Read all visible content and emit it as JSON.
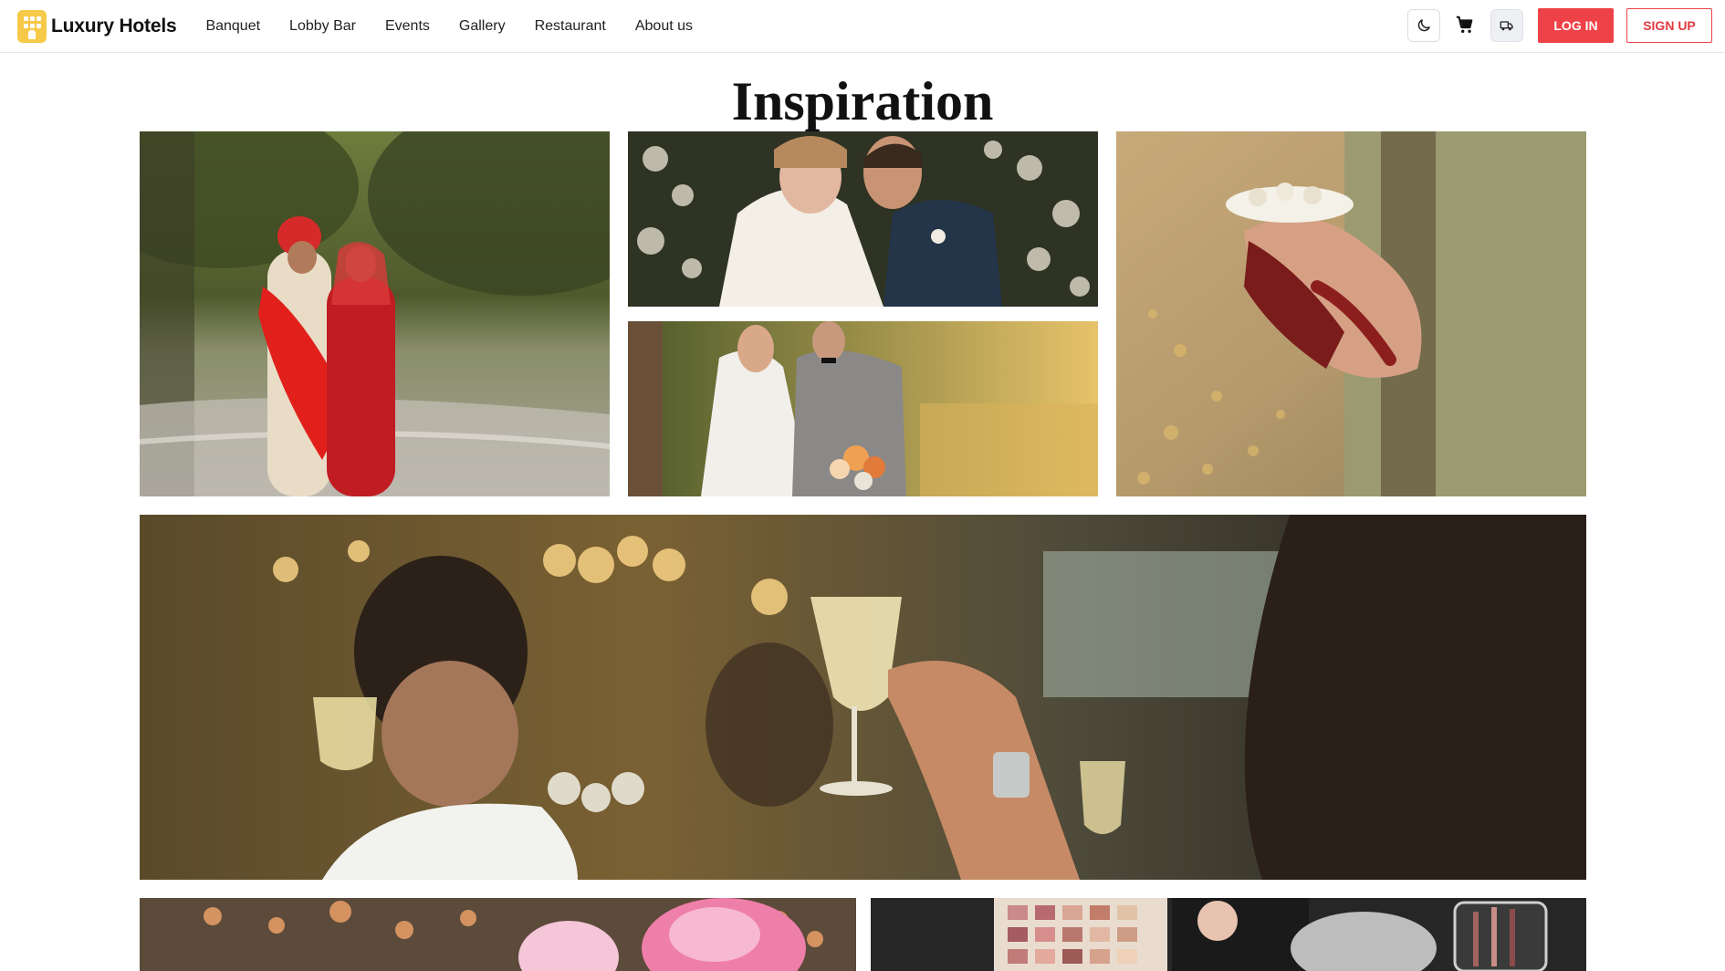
{
  "brand": {
    "name": "Luxury Hotels"
  },
  "nav": {
    "items": [
      "Banquet",
      "Lobby Bar",
      "Events",
      "Gallery",
      "Restaurant",
      "About us"
    ]
  },
  "header_actions": {
    "theme_toggle_icon": "moon-icon",
    "cart_icon": "cart-icon",
    "delivery_icon": "truck-icon",
    "login_label": "LOG IN",
    "signup_label": "SIGN UP"
  },
  "page": {
    "title": "Inspiration"
  },
  "gallery": {
    "images": [
      {
        "name": "couple-by-river-photo"
      },
      {
        "name": "couple-kiss-flowers-photo"
      },
      {
        "name": "couple-lake-bouquet-photo"
      },
      {
        "name": "henna-hands-photo"
      },
      {
        "name": "champagne-toast-photo"
      },
      {
        "name": "pink-flowers-photo"
      },
      {
        "name": "makeup-palette-photo"
      }
    ]
  },
  "colors": {
    "accent": "#ef4248",
    "logo": "#f7c948"
  }
}
